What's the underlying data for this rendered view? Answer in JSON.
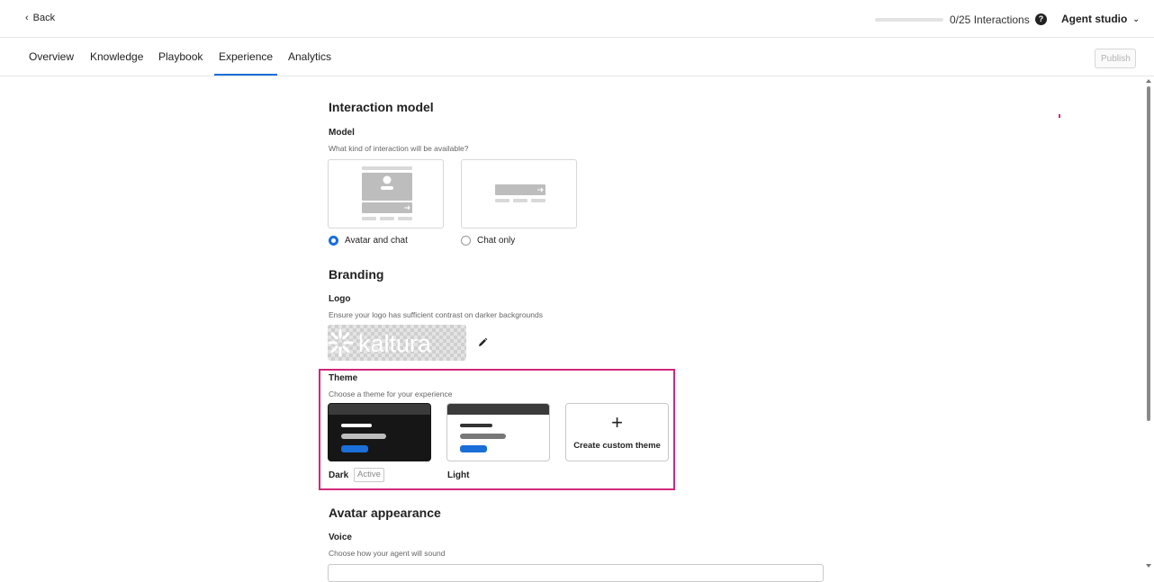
{
  "topbar": {
    "back_label": "Back",
    "interactions_label": "0/25 Interactions",
    "progress_fraction": 0,
    "studio_label": "Agent studio"
  },
  "tabs": [
    {
      "label": "Overview"
    },
    {
      "label": "Knowledge"
    },
    {
      "label": "Playbook"
    },
    {
      "label": "Experience",
      "active": true
    },
    {
      "label": "Analytics"
    }
  ],
  "publish_label": "Publish",
  "sections": {
    "interaction": {
      "title": "Interaction model",
      "model_label": "Model",
      "model_desc": "What kind of interaction will be available?",
      "options": [
        {
          "label": "Avatar and chat",
          "selected": true
        },
        {
          "label": "Chat only",
          "selected": false
        }
      ]
    },
    "branding": {
      "title": "Branding",
      "logo_label": "Logo",
      "logo_desc": "Ensure your logo has sufficient contrast on darker backgrounds",
      "logo_text": "kaltura",
      "theme_label": "Theme",
      "theme_desc": "Choose a theme for your experience",
      "themes": [
        {
          "name": "Dark",
          "badge": "Active"
        },
        {
          "name": "Light"
        }
      ],
      "create_custom_label": "Create custom theme"
    },
    "avatar": {
      "title": "Avatar appearance",
      "voice_label": "Voice",
      "voice_desc": "Choose how your agent will sound"
    }
  },
  "colors": {
    "accent": "#1a6fd8",
    "highlight_frame": "#d1287a",
    "dark_theme_bg": "#161616"
  }
}
